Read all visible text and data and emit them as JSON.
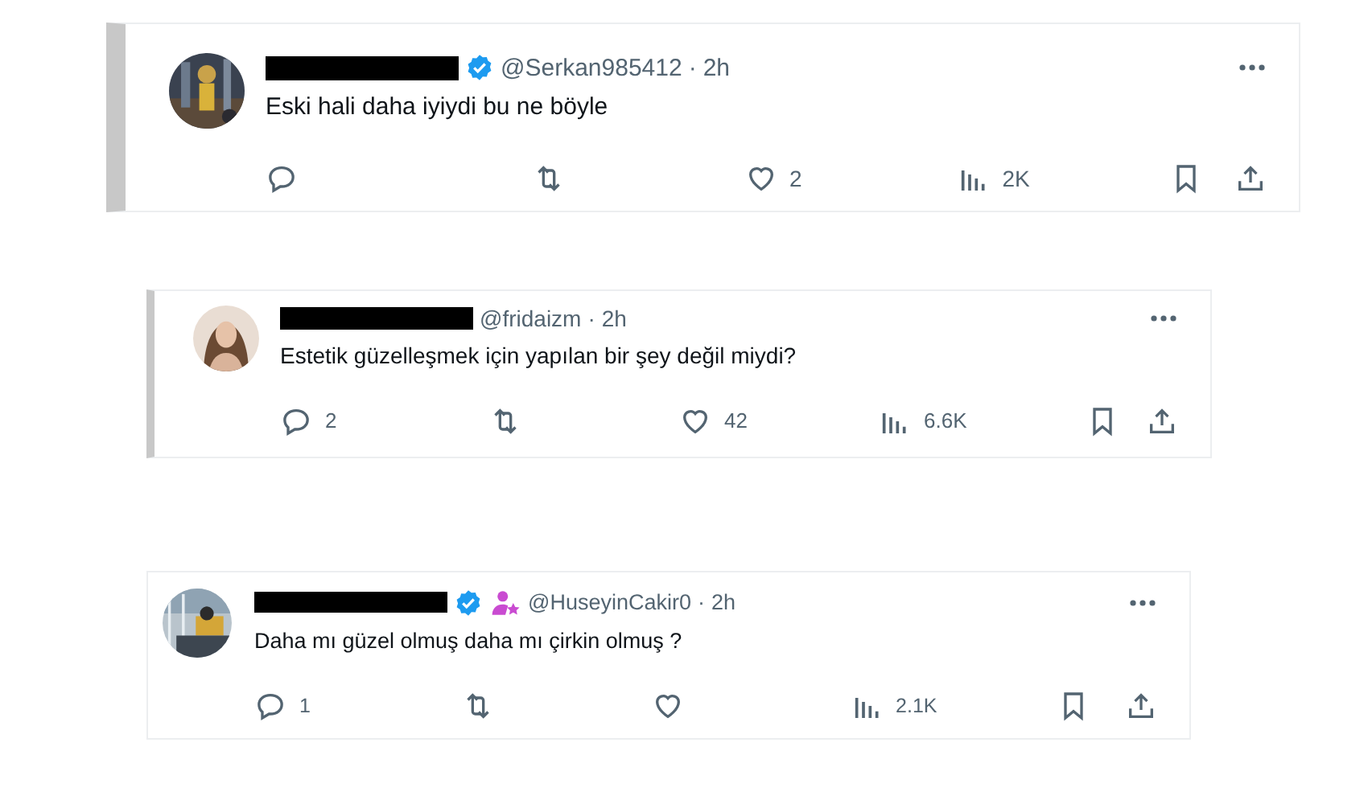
{
  "tweets": [
    {
      "name_redacted": true,
      "verified": true,
      "handle": "@Serkan985412",
      "separator": "·",
      "time": "2h",
      "text": "Eski hali daha iyiydi bu ne böyle",
      "likes": "2",
      "views": "2K"
    },
    {
      "name_redacted": true,
      "verified": false,
      "handle": "@fridaizm",
      "separator": "·",
      "time": "2h",
      "text": "Estetik güzelleşmek için yapılan bir şey değil miydi?",
      "replies": "2",
      "likes": "42",
      "views": "6.6K"
    },
    {
      "name_redacted": true,
      "verified": true,
      "affiliate_badge": true,
      "handle": "@HuseyinCakir0",
      "separator": "·",
      "time": "2h",
      "text": "Daha mı güzel olmuş daha mı çirkin olmuş ?",
      "replies": "1",
      "views": "2.1K"
    }
  ]
}
